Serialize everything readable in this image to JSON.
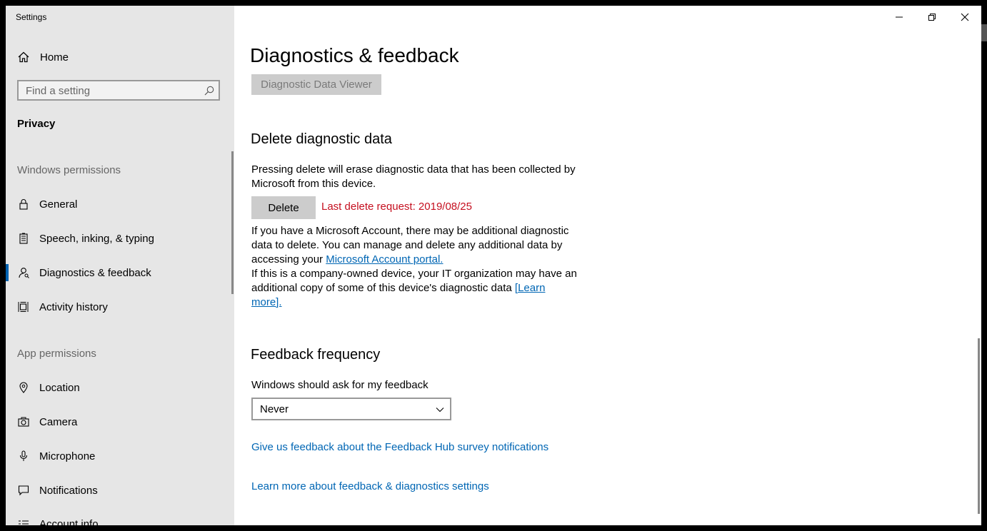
{
  "window": {
    "title": "Settings"
  },
  "sidebar": {
    "home_label": "Home",
    "search_placeholder": "Find a setting",
    "section_label": "Privacy",
    "groups": [
      {
        "heading": "Windows permissions",
        "items": [
          {
            "label": "General",
            "icon": "lock-icon"
          },
          {
            "label": "Speech, inking, & typing",
            "icon": "speech-icon"
          },
          {
            "label": "Diagnostics & feedback",
            "icon": "diagnostics-icon",
            "selected": true
          },
          {
            "label": "Activity history",
            "icon": "activity-icon"
          }
        ]
      },
      {
        "heading": "App permissions",
        "items": [
          {
            "label": "Location",
            "icon": "location-icon"
          },
          {
            "label": "Camera",
            "icon": "camera-icon"
          },
          {
            "label": "Microphone",
            "icon": "microphone-icon"
          },
          {
            "label": "Notifications",
            "icon": "notifications-icon"
          },
          {
            "label": "Account info",
            "icon": "account-info-icon"
          }
        ]
      }
    ]
  },
  "main": {
    "title": "Diagnostics & feedback",
    "viewer_button": "Diagnostic Data Viewer",
    "delete_section": {
      "heading": "Delete diagnostic data",
      "description": "Pressing delete will erase diagnostic data that has been collected by Microsoft from this device.",
      "delete_button": "Delete",
      "last_request": "Last delete request: 2019/08/25",
      "account_text": "If you have a Microsoft Account, there may be additional diagnostic data to delete. You can manage and delete any additional data by accessing your",
      "account_link": "Microsoft Account portal.",
      "company_text": "If this is a company-owned device, your IT organization may have an additional copy of some of this device's diagnostic data",
      "learn_more_link": "[Learn more]."
    },
    "feedback_section": {
      "heading": "Feedback frequency",
      "label": "Windows should ask for my feedback",
      "selected_option": "Never",
      "hub_link": "Give us feedback about the Feedback Hub survey notifications",
      "learn_link": "Learn more about feedback & diagnostics settings"
    }
  },
  "colors": {
    "accent": "#0063b1",
    "link": "#0066b4",
    "warning": "#c50f1f",
    "sidebar_bg": "#e6e6e6"
  }
}
